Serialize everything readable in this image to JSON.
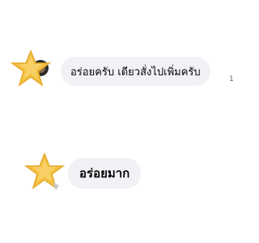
{
  "comments": [
    {
      "avatar_icon": "star-icon",
      "text": "อร่อยครับ เดียวสั่งไปเพิ่มครับ",
      "side_count": "1"
    },
    {
      "avatar_icon": "star-icon",
      "text": "อร่อยมาก"
    }
  ],
  "colors": {
    "bubble_bg": "#f0f2f5",
    "star_fill": "#f5c242",
    "star_shadow": "#e6a92b"
  }
}
